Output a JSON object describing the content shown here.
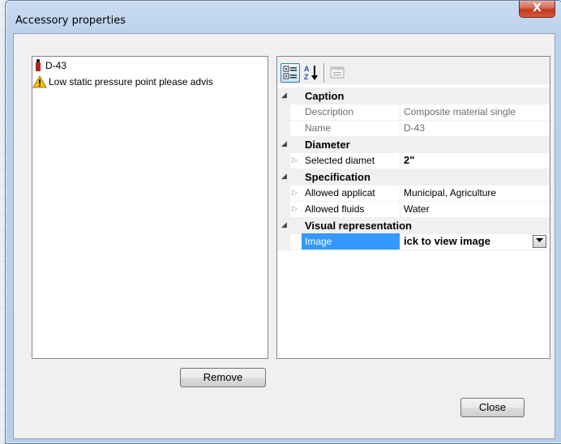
{
  "window": {
    "title": "Accessory properties",
    "close_glyph": "X"
  },
  "list": {
    "items": [
      {
        "text": "D-43",
        "icon": "valve-icon"
      },
      {
        "text": "Low static pressure point please advis",
        "icon": "warning-icon"
      }
    ]
  },
  "buttons": {
    "remove_label": "Remove",
    "close_label": "Close"
  },
  "grid": {
    "categories": [
      {
        "label": "Caption",
        "rows": [
          {
            "name": "Description",
            "value": "Composite material single"
          },
          {
            "name": "Name",
            "value": "D-43"
          }
        ]
      },
      {
        "label": "Diameter",
        "rows": [
          {
            "name": "Selected diamet",
            "value": "2\""
          }
        ]
      },
      {
        "label": "Specification",
        "rows": [
          {
            "name": "Allowed applicat",
            "value": "Municipal, Agriculture"
          },
          {
            "name": "Allowed fluids",
            "value": "Water"
          }
        ]
      },
      {
        "label": "Visual representation",
        "rows": [
          {
            "name": "Image",
            "value": "ick to view image"
          }
        ]
      }
    ]
  },
  "colors": {
    "selection": "#3399ff",
    "accent_red": "#c2381d"
  }
}
